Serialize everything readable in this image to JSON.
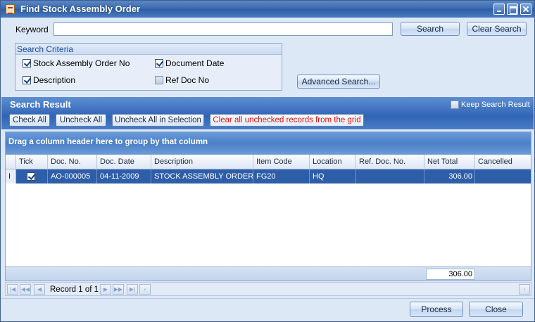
{
  "window": {
    "title": "Find Stock Assembly Order"
  },
  "keyword": {
    "label": "Keyword",
    "value": ""
  },
  "buttons": {
    "search": "Search",
    "clear_search": "Clear Search",
    "advanced_search": "Advanced Search...",
    "process": "Process",
    "close": "Close"
  },
  "criteria": {
    "title": "Search Criteria",
    "items": [
      {
        "label": "Stock Assembly Order No",
        "checked": true
      },
      {
        "label": "Document Date",
        "checked": true
      },
      {
        "label": "Description",
        "checked": true
      },
      {
        "label": "Ref Doc No",
        "checked": false
      }
    ]
  },
  "result": {
    "title": "Search Result",
    "keep_label": "Keep Search Result",
    "check_all": "Check All",
    "uncheck_all": "Uncheck All",
    "uncheck_selection": "Uncheck All in Selection",
    "clear_unchecked": "Clear all unchecked records from the grid"
  },
  "grid": {
    "group_hint": "Drag a column header here to group by that column",
    "columns": [
      "Tick",
      "Doc. No.",
      "Doc. Date",
      "Description",
      "Item Code",
      "Location",
      "Ref. Doc. No.",
      "Net Total",
      "Cancelled"
    ],
    "rows": [
      {
        "indicator": "I",
        "tick": true,
        "doc_no": "AO-000005",
        "doc_date": "04-11-2009",
        "description": "STOCK ASSEMBLY ORDER",
        "item_code": "FG20",
        "location": "HQ",
        "ref_doc_no": "",
        "net_total": "306.00",
        "cancelled": ""
      }
    ],
    "footer_total": "306.00"
  },
  "navigator": {
    "record_text": "Record 1 of 1"
  },
  "colors": {
    "title_bar": "#3d6bb0",
    "result_band": "#3f72bf",
    "selected_row": "#2f5ea8",
    "warning_text": "#e21010"
  }
}
